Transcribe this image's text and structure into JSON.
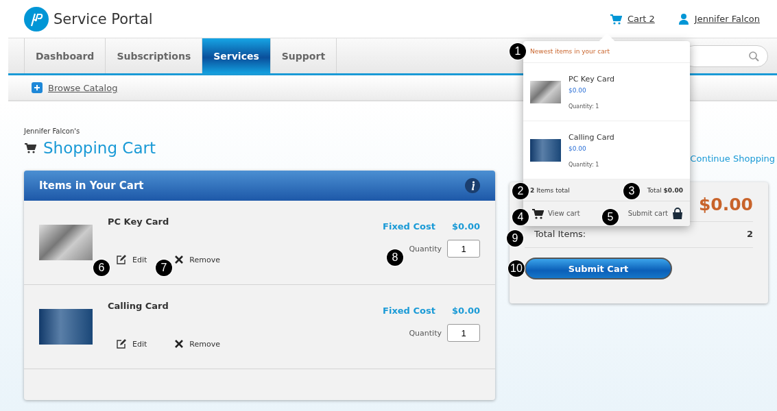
{
  "header": {
    "brand": "Service Portal",
    "cart_link": "Cart 2",
    "user_link": "Jennifer Falcon"
  },
  "nav": {
    "tabs": [
      {
        "label": "Dashboard",
        "selected": false
      },
      {
        "label": "Subscriptions",
        "selected": false
      },
      {
        "label": "Services",
        "selected": true
      },
      {
        "label": "Support",
        "selected": false
      }
    ]
  },
  "subnav": {
    "link": "Browse Catalog"
  },
  "page": {
    "owner": "Jennifer Falcon's",
    "title": "Shopping Cart",
    "continue_link": "Continue Shopping"
  },
  "cart_panel": {
    "title": "Items in Your Cart",
    "items": [
      {
        "name": "PC Key Card",
        "cost_label": "Fixed Cost",
        "cost": "$0.00",
        "quantity_label": "Quantity",
        "quantity": "1",
        "edit": "Edit",
        "remove": "Remove"
      },
      {
        "name": "Calling Card",
        "cost_label": "Fixed Cost",
        "cost": "$0.00",
        "quantity_label": "Quantity",
        "quantity": "1",
        "edit": "Edit",
        "remove": "Remove"
      }
    ]
  },
  "summary": {
    "total": "$0.00",
    "items_label": "Total Items:",
    "items_count": "2",
    "button": "Submit Cart"
  },
  "dropdown": {
    "heading": "Newest items in your cart",
    "items": [
      {
        "name": "PC Key Card",
        "price": "$0.00",
        "quantity": "Quantity: 1"
      },
      {
        "name": "Calling Card",
        "price": "$0.00",
        "quantity": "Quantity: 1"
      }
    ],
    "items_total": "**2** Items total",
    "total": "Total **$0.00**",
    "view": "View cart",
    "submit": "Submit cart"
  },
  "callouts": [
    {
      "number": "1"
    },
    {
      "number": "2"
    },
    {
      "number": "3"
    },
    {
      "number": "4"
    },
    {
      "number": "5"
    },
    {
      "number": "6"
    },
    {
      "number": "7"
    },
    {
      "number": "8"
    },
    {
      "number": "9"
    },
    {
      "number": "10"
    }
  ]
}
